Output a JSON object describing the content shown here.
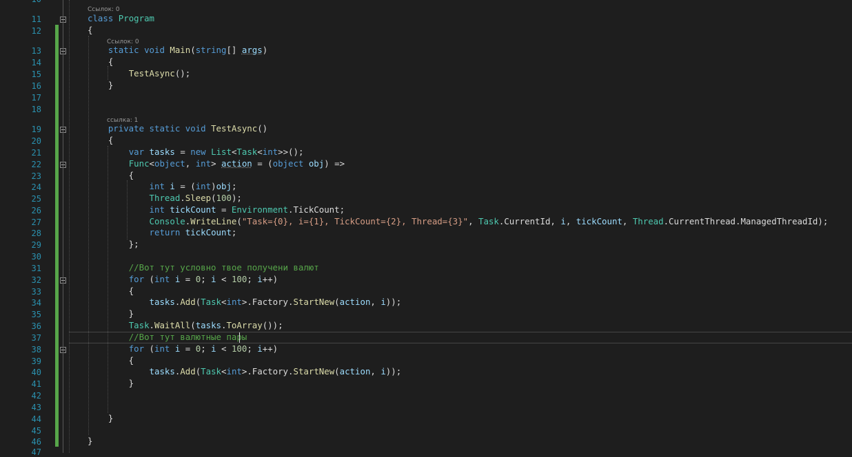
{
  "editor": {
    "first_line_partial": "10",
    "last_line_partial": "47",
    "lines": [
      {
        "n": "11",
        "tokens": [
          [
            "kw",
            "class"
          ],
          [
            "pl",
            " "
          ],
          [
            "ty",
            "Program"
          ]
        ]
      },
      {
        "n": "12",
        "tokens": [
          [
            "pl",
            "{"
          ]
        ]
      },
      {
        "n": "13",
        "tokens": [
          [
            "pl",
            "    "
          ],
          [
            "kw",
            "static"
          ],
          [
            "pl",
            " "
          ],
          [
            "kw",
            "void"
          ],
          [
            "pl",
            " "
          ],
          [
            "fn",
            "Main"
          ],
          [
            "pl",
            "("
          ],
          [
            "kw",
            "string"
          ],
          [
            "pl",
            "[] "
          ],
          [
            "id",
            "args"
          ],
          [
            "pl",
            ")"
          ]
        ]
      },
      {
        "n": "14",
        "tokens": [
          [
            "pl",
            "    {"
          ]
        ]
      },
      {
        "n": "15",
        "tokens": [
          [
            "pl",
            "        "
          ],
          [
            "fn",
            "TestAsync"
          ],
          [
            "pl",
            "();"
          ]
        ]
      },
      {
        "n": "16",
        "tokens": [
          [
            "pl",
            "    }"
          ]
        ]
      },
      {
        "n": "17",
        "tokens": []
      },
      {
        "n": "18",
        "tokens": []
      },
      {
        "n": "19",
        "tokens": [
          [
            "pl",
            "    "
          ],
          [
            "kw",
            "private"
          ],
          [
            "pl",
            " "
          ],
          [
            "kw",
            "static"
          ],
          [
            "pl",
            " "
          ],
          [
            "kw",
            "void"
          ],
          [
            "pl",
            " "
          ],
          [
            "fn",
            "TestAsync"
          ],
          [
            "pl",
            "()"
          ]
        ]
      },
      {
        "n": "20",
        "tokens": [
          [
            "pl",
            "    {"
          ]
        ]
      },
      {
        "n": "21",
        "tokens": [
          [
            "pl",
            "        "
          ],
          [
            "kw",
            "var"
          ],
          [
            "pl",
            " "
          ],
          [
            "id",
            "tasks"
          ],
          [
            "pl",
            " = "
          ],
          [
            "kw",
            "new"
          ],
          [
            "pl",
            " "
          ],
          [
            "ty",
            "List"
          ],
          [
            "pl",
            "<"
          ],
          [
            "ty",
            "Task"
          ],
          [
            "pl",
            "<"
          ],
          [
            "kw",
            "int"
          ],
          [
            "pl",
            ">>();"
          ]
        ]
      },
      {
        "n": "22",
        "tokens": [
          [
            "pl",
            "        "
          ],
          [
            "ty",
            "Func"
          ],
          [
            "pl",
            "<"
          ],
          [
            "kw",
            "object"
          ],
          [
            "pl",
            ", "
          ],
          [
            "kw",
            "int"
          ],
          [
            "pl",
            "> "
          ],
          [
            "id",
            "action"
          ],
          [
            "pl",
            " = ("
          ],
          [
            "kw",
            "object"
          ],
          [
            "pl",
            " "
          ],
          [
            "id",
            "obj"
          ],
          [
            "pl",
            ") =>"
          ]
        ]
      },
      {
        "n": "23",
        "tokens": [
          [
            "pl",
            "        {"
          ]
        ]
      },
      {
        "n": "24",
        "tokens": [
          [
            "pl",
            "            "
          ],
          [
            "kw",
            "int"
          ],
          [
            "pl",
            " "
          ],
          [
            "id",
            "i"
          ],
          [
            "pl",
            " = ("
          ],
          [
            "kw",
            "int"
          ],
          [
            "pl",
            ")"
          ],
          [
            "id",
            "obj"
          ],
          [
            "pl",
            ";"
          ]
        ]
      },
      {
        "n": "25",
        "tokens": [
          [
            "pl",
            "            "
          ],
          [
            "ty",
            "Thread"
          ],
          [
            "pl",
            "."
          ],
          [
            "fn",
            "Sleep"
          ],
          [
            "pl",
            "("
          ],
          [
            "num",
            "100"
          ],
          [
            "pl",
            ");"
          ]
        ]
      },
      {
        "n": "26",
        "tokens": [
          [
            "pl",
            "            "
          ],
          [
            "kw",
            "int"
          ],
          [
            "pl",
            " "
          ],
          [
            "id",
            "tickCount"
          ],
          [
            "pl",
            " = "
          ],
          [
            "ty",
            "Environment"
          ],
          [
            "pl",
            ".TickCount;"
          ]
        ]
      },
      {
        "n": "27",
        "tokens": [
          [
            "pl",
            "            "
          ],
          [
            "ty",
            "Console"
          ],
          [
            "pl",
            "."
          ],
          [
            "fn",
            "WriteLine"
          ],
          [
            "pl",
            "("
          ],
          [
            "str",
            "\"Task={0}, i={1}, TickCount={2}, Thread={3}\""
          ],
          [
            "pl",
            ", "
          ],
          [
            "ty",
            "Task"
          ],
          [
            "pl",
            ".CurrentId, "
          ],
          [
            "id",
            "i"
          ],
          [
            "pl",
            ", "
          ],
          [
            "id",
            "tickCount"
          ],
          [
            "pl",
            ", "
          ],
          [
            "ty",
            "Thread"
          ],
          [
            "pl",
            ".CurrentThread.ManagedThreadId);"
          ]
        ]
      },
      {
        "n": "28",
        "tokens": [
          [
            "pl",
            "            "
          ],
          [
            "kw",
            "return"
          ],
          [
            "pl",
            " "
          ],
          [
            "id",
            "tickCount"
          ],
          [
            "pl",
            ";"
          ]
        ]
      },
      {
        "n": "29",
        "tokens": [
          [
            "pl",
            "        };"
          ]
        ]
      },
      {
        "n": "30",
        "tokens": []
      },
      {
        "n": "31",
        "tokens": [
          [
            "pl",
            "        "
          ],
          [
            "cmt",
            "//Вот тут условно твое получени валют"
          ]
        ]
      },
      {
        "n": "32",
        "tokens": [
          [
            "pl",
            "        "
          ],
          [
            "kw",
            "for"
          ],
          [
            "pl",
            " ("
          ],
          [
            "kw",
            "int"
          ],
          [
            "pl",
            " "
          ],
          [
            "id",
            "i"
          ],
          [
            "pl",
            " = "
          ],
          [
            "num",
            "0"
          ],
          [
            "pl",
            "; "
          ],
          [
            "id",
            "i"
          ],
          [
            "pl",
            " < "
          ],
          [
            "num",
            "100"
          ],
          [
            "pl",
            "; "
          ],
          [
            "id",
            "i"
          ],
          [
            "pl",
            "++)"
          ]
        ]
      },
      {
        "n": "33",
        "tokens": [
          [
            "pl",
            "        {"
          ]
        ]
      },
      {
        "n": "34",
        "tokens": [
          [
            "pl",
            "            "
          ],
          [
            "id",
            "tasks"
          ],
          [
            "pl",
            "."
          ],
          [
            "fn",
            "Add"
          ],
          [
            "pl",
            "("
          ],
          [
            "ty",
            "Task"
          ],
          [
            "pl",
            "<"
          ],
          [
            "kw",
            "int"
          ],
          [
            "pl",
            ">.Factory."
          ],
          [
            "fn",
            "StartNew"
          ],
          [
            "pl",
            "("
          ],
          [
            "id",
            "action"
          ],
          [
            "pl",
            ", "
          ],
          [
            "id",
            "i"
          ],
          [
            "pl",
            "));"
          ]
        ]
      },
      {
        "n": "35",
        "tokens": [
          [
            "pl",
            "        }"
          ]
        ]
      },
      {
        "n": "36",
        "tokens": [
          [
            "pl",
            "        "
          ],
          [
            "ty",
            "Task"
          ],
          [
            "pl",
            "."
          ],
          [
            "fn",
            "WaitAll"
          ],
          [
            "pl",
            "("
          ],
          [
            "id",
            "tasks"
          ],
          [
            "pl",
            "."
          ],
          [
            "fn",
            "ToArray"
          ],
          [
            "pl",
            "());"
          ]
        ]
      },
      {
        "n": "37",
        "tokens": [
          [
            "pl",
            "        "
          ],
          [
            "cmt",
            "//Вот тут валютные пары"
          ]
        ]
      },
      {
        "n": "38",
        "tokens": [
          [
            "pl",
            "        "
          ],
          [
            "kw",
            "for"
          ],
          [
            "pl",
            " ("
          ],
          [
            "kw",
            "int"
          ],
          [
            "pl",
            " "
          ],
          [
            "id",
            "i"
          ],
          [
            "pl",
            " = "
          ],
          [
            "num",
            "0"
          ],
          [
            "pl",
            "; "
          ],
          [
            "id",
            "i"
          ],
          [
            "pl",
            " < "
          ],
          [
            "num",
            "100"
          ],
          [
            "pl",
            "; "
          ],
          [
            "id",
            "i"
          ],
          [
            "pl",
            "++)"
          ]
        ]
      },
      {
        "n": "39",
        "tokens": [
          [
            "pl",
            "        {"
          ]
        ]
      },
      {
        "n": "40",
        "tokens": [
          [
            "pl",
            "            "
          ],
          [
            "id",
            "tasks"
          ],
          [
            "pl",
            "."
          ],
          [
            "fn",
            "Add"
          ],
          [
            "pl",
            "("
          ],
          [
            "ty",
            "Task"
          ],
          [
            "pl",
            "<"
          ],
          [
            "kw",
            "int"
          ],
          [
            "pl",
            ">.Factory."
          ],
          [
            "fn",
            "StartNew"
          ],
          [
            "pl",
            "("
          ],
          [
            "id",
            "action"
          ],
          [
            "pl",
            ", "
          ],
          [
            "id",
            "i"
          ],
          [
            "pl",
            "));"
          ]
        ]
      },
      {
        "n": "41",
        "tokens": [
          [
            "pl",
            "        }"
          ]
        ]
      },
      {
        "n": "42",
        "tokens": []
      },
      {
        "n": "43",
        "tokens": []
      },
      {
        "n": "44",
        "tokens": [
          [
            "pl",
            "    }"
          ]
        ]
      },
      {
        "n": "45",
        "tokens": []
      },
      {
        "n": "46",
        "tokens": [
          [
            "pl",
            "}"
          ]
        ]
      }
    ],
    "code_lens": {
      "class_refs": "Ссылок: 0",
      "main_refs": "Ссылок: 0",
      "testasync_refs": "ссылка: 1"
    },
    "colors": {
      "background": "#1e1e1e",
      "line_number": "#2b91af",
      "keyword": "#569cd6",
      "type": "#4ec9b0",
      "method": "#dcdcaa",
      "identifier": "#9cdcfe",
      "string": "#d69d85",
      "number": "#b5cea8",
      "comment": "#57a64a",
      "change_bar": "#57a64a"
    }
  }
}
